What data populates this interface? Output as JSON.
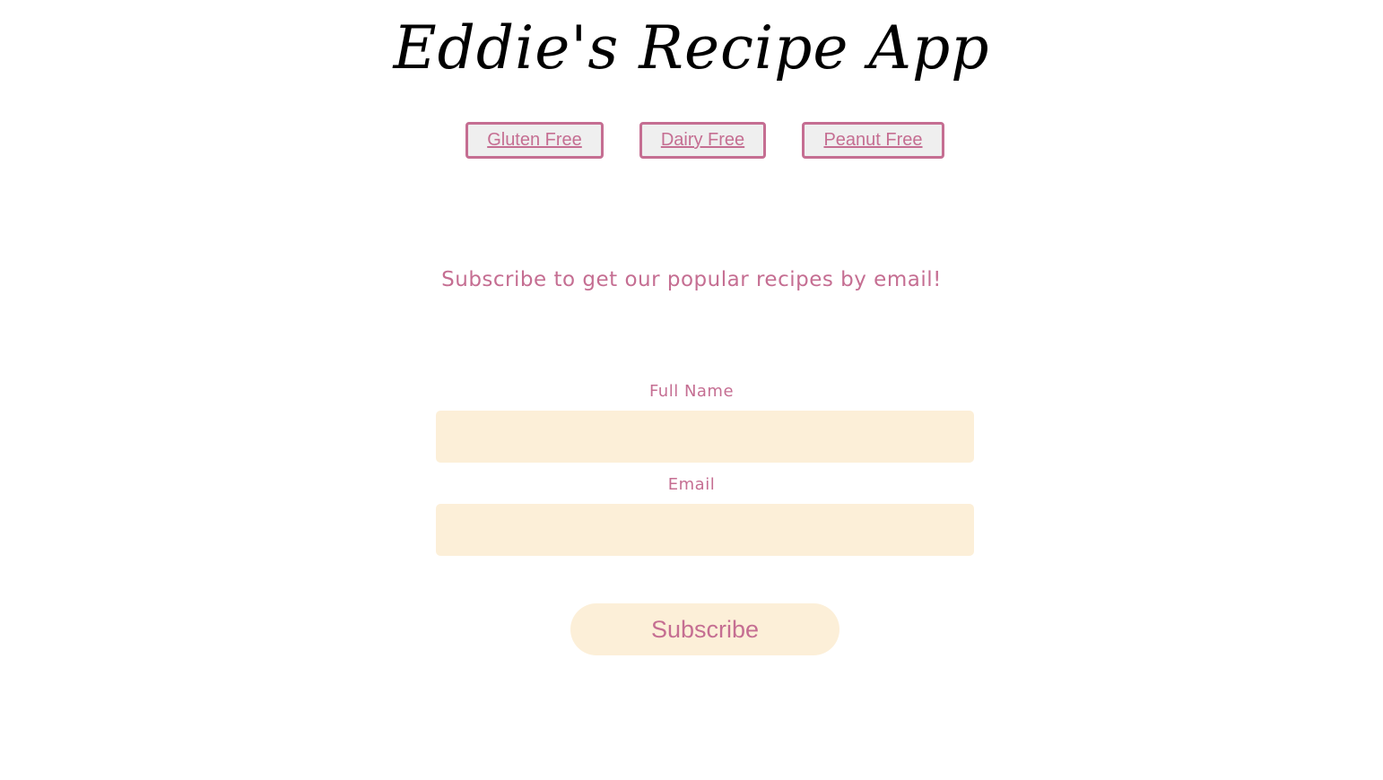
{
  "header": {
    "title": "Eddie's Recipe App"
  },
  "nav": {
    "items": [
      {
        "label": "Gluten Free"
      },
      {
        "label": "Dairy Free"
      },
      {
        "label": "Peanut Free"
      }
    ]
  },
  "subscribe_section": {
    "tagline": "Subscribe to get our popular recipes by email!",
    "full_name_label": "Full Name",
    "full_name_value": "",
    "email_label": "Email",
    "email_value": "",
    "submit_label": "Subscribe"
  },
  "colors": {
    "accent": "#c56e92",
    "input_background": "#fcefd8",
    "nav_button_background": "#efefef",
    "title_color": "#000000"
  }
}
